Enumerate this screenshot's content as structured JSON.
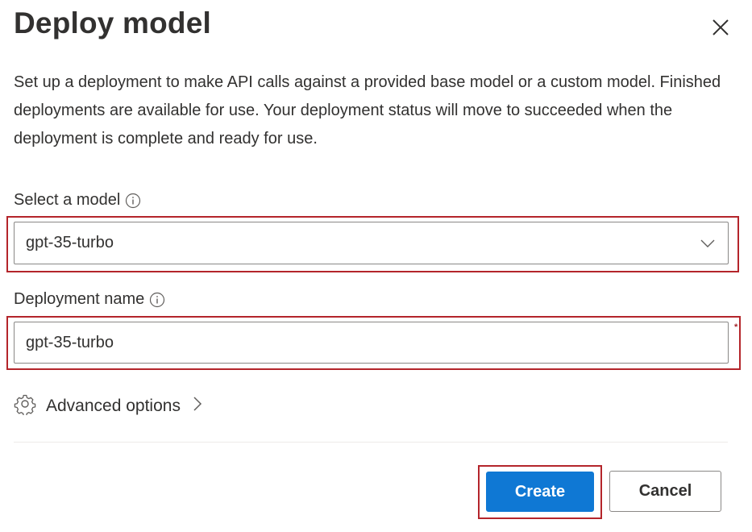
{
  "dialog": {
    "title": "Deploy model",
    "description": "Set up a deployment to make API calls against a provided base model or a custom model. Finished deployments are available for use. Your deployment status will move to succeeded when the deployment is complete and ready for use."
  },
  "model_select": {
    "label": "Select a model",
    "value": "gpt-35-turbo"
  },
  "deployment_name": {
    "label": "Deployment name",
    "value": "gpt-35-turbo",
    "required_mark": "*"
  },
  "advanced": {
    "label": "Advanced options"
  },
  "footer": {
    "create_label": "Create",
    "cancel_label": "Cancel"
  },
  "colors": {
    "accent": "#0f78d4",
    "highlight": "#b4252b"
  }
}
